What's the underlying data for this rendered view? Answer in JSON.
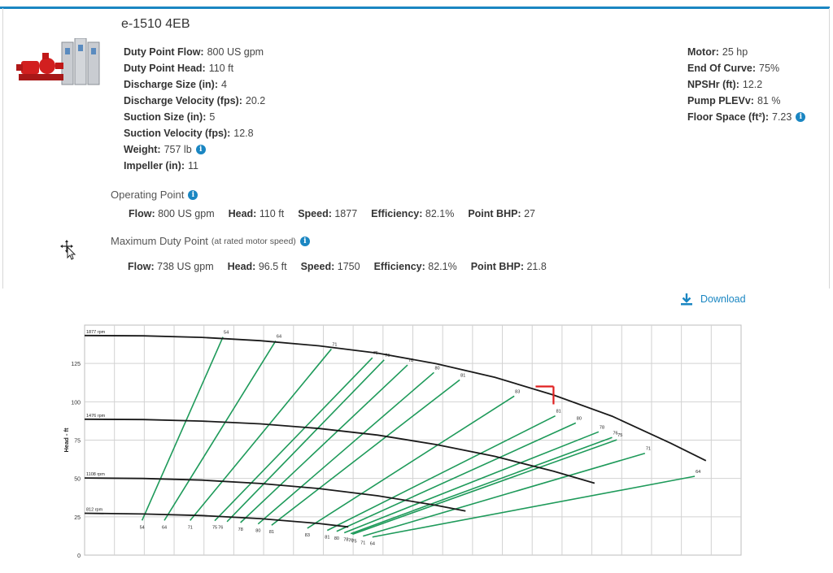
{
  "pump": {
    "title": "e-1510 4EB",
    "left_specs": [
      {
        "label": "Duty Point Flow:",
        "value": "800 US gpm",
        "info": false
      },
      {
        "label": "Duty Point Head:",
        "value": "110 ft",
        "info": false
      },
      {
        "label": "Discharge Size (in):",
        "value": "4",
        "info": false
      },
      {
        "label": "Discharge Velocity (fps):",
        "value": "20.2",
        "info": false
      },
      {
        "label": "Suction Size (in):",
        "value": "5",
        "info": false
      },
      {
        "label": "Suction Velocity (fps):",
        "value": "12.8",
        "info": false
      },
      {
        "label": "Weight:",
        "value": "757 lb",
        "info": true
      },
      {
        "label": "Impeller (in):",
        "value": "11",
        "info": false
      }
    ],
    "right_specs": [
      {
        "label": "Motor:",
        "value": "25 hp",
        "info": false
      },
      {
        "label": "End Of Curve:",
        "value": "75%",
        "info": false
      },
      {
        "label": "NPSHr (ft):",
        "value": "12.2",
        "info": false
      },
      {
        "label": "Pump PLEVv:",
        "value": "81 %",
        "info": false
      },
      {
        "label": "Floor Space (ft²):",
        "value": "7.23",
        "info": true
      }
    ]
  },
  "operating_point": {
    "heading": "Operating Point",
    "items": [
      {
        "label": "Flow:",
        "value": "800 US gpm"
      },
      {
        "label": "Head:",
        "value": "110 ft"
      },
      {
        "label": "Speed:",
        "value": "1877"
      },
      {
        "label": "Efficiency:",
        "value": "82.1%"
      },
      {
        "label": "Point BHP:",
        "value": "27"
      }
    ]
  },
  "max_duty_point": {
    "heading": "Maximum Duty Point",
    "note": "(at rated motor speed)",
    "items": [
      {
        "label": "Flow:",
        "value": "738 US gpm"
      },
      {
        "label": "Head:",
        "value": "96.5 ft"
      },
      {
        "label": "Speed:",
        "value": "1750"
      },
      {
        "label": "Efficiency:",
        "value": "82.1%"
      },
      {
        "label": "Point BHP:",
        "value": "21.8"
      }
    ]
  },
  "download_label": "Download",
  "icons": {
    "info": "info-icon",
    "download": "download-icon",
    "cursor": "move-cursor-icon"
  },
  "colors": {
    "accent": "#1a86c2",
    "curve": "#1a1a1a",
    "efficiency": "#1e9a5a",
    "marker": "#e02020"
  },
  "chart_data": {
    "type": "line",
    "ylabel": "Head - ft",
    "y_ticks": [
      "0",
      "25",
      "50",
      "75",
      "100",
      "125"
    ],
    "ylim": [
      0,
      150
    ],
    "xlim": [
      0,
      1120
    ],
    "grid": true,
    "speed_curves": [
      {
        "name": "1877 rpm",
        "points": [
          [
            0,
            143.2
          ],
          [
            100,
            143.0
          ],
          [
            200,
            142.0
          ],
          [
            300,
            139.8
          ],
          [
            400,
            136.5
          ],
          [
            500,
            131.7
          ],
          [
            600,
            124.8
          ],
          [
            700,
            115.9
          ],
          [
            800,
            104.4
          ],
          [
            900,
            90.6
          ],
          [
            1000,
            73.0
          ],
          [
            1060,
            61.6
          ]
        ]
      },
      {
        "name": "1476 rpm",
        "points": [
          [
            0,
            88.6
          ],
          [
            100,
            88.4
          ],
          [
            200,
            87.4
          ],
          [
            300,
            85.6
          ],
          [
            400,
            82.6
          ],
          [
            500,
            78.3
          ],
          [
            600,
            72.1
          ],
          [
            700,
            64.4
          ],
          [
            800,
            54.7
          ],
          [
            870,
            46.9
          ]
        ]
      },
      {
        "name": "1108 rpm",
        "points": [
          [
            0,
            50.3
          ],
          [
            100,
            50.0
          ],
          [
            200,
            48.9
          ],
          [
            300,
            46.7
          ],
          [
            400,
            43.4
          ],
          [
            500,
            38.7
          ],
          [
            600,
            32.5
          ],
          [
            650,
            28.8
          ]
        ]
      },
      {
        "name": "812 rpm",
        "points": [
          [
            0,
            27.3
          ],
          [
            100,
            26.8
          ],
          [
            200,
            25.8
          ],
          [
            300,
            23.8
          ],
          [
            400,
            20.6
          ],
          [
            450,
            18.4
          ]
        ]
      }
    ],
    "efficiency_lines": [
      {
        "name": "54",
        "points": [
          [
            98,
            22.6
          ],
          [
            236,
            142.2
          ]
        ]
      },
      {
        "name": "64",
        "points": [
          [
            136,
            22.6
          ],
          [
            326,
            139.7
          ]
        ]
      },
      {
        "name": "71",
        "points": [
          [
            180,
            22.6
          ],
          [
            421,
            134.4
          ]
        ]
      },
      {
        "name": "75",
        "points": [
          [
            222,
            22.4
          ],
          [
            491,
            128.7
          ]
        ]
      },
      {
        "name": "76",
        "points": [
          [
            243,
            21.8
          ],
          [
            511,
            127.3
          ]
        ]
      },
      {
        "name": "78",
        "points": [
          [
            266,
            21.2
          ],
          [
            551,
            124.0
          ]
        ]
      },
      {
        "name": "80",
        "points": [
          [
            296,
            20.3
          ],
          [
            596,
            119.1
          ]
        ]
      },
      {
        "name": "81",
        "points": [
          [
            319,
            19.5
          ],
          [
            640,
            114.3
          ]
        ]
      },
      {
        "name": "83",
        "points": [
          [
            380,
            17.5
          ],
          [
            733,
            103.7
          ]
        ]
      },
      {
        "name": "81",
        "points": [
          [
            414,
            16.1
          ],
          [
            803,
            90.8
          ]
        ]
      },
      {
        "name": "80",
        "points": [
          [
            430,
            15.5
          ],
          [
            838,
            86.2
          ]
        ]
      },
      {
        "name": "78",
        "points": [
          [
            443,
            14.6
          ],
          [
            877,
            80.4
          ]
        ]
      },
      {
        "name": "76",
        "points": [
          [
            454,
            14.0
          ],
          [
            900,
            76.7
          ]
        ]
      },
      {
        "name": "75",
        "points": [
          [
            457,
            13.6
          ],
          [
            908,
            75.2
          ]
        ]
      },
      {
        "name": "71",
        "points": [
          [
            475,
            12.4
          ],
          [
            956,
            66.4
          ]
        ]
      },
      {
        "name": "64",
        "points": [
          [
            491,
            11.8
          ],
          [
            1041,
            51.4
          ]
        ]
      }
    ],
    "top_labels": [
      {
        "text": "54",
        "x": 236,
        "y": 142.2
      },
      {
        "text": "64",
        "x": 326,
        "y": 139.7
      },
      {
        "text": "71",
        "x": 421,
        "y": 134.4
      },
      {
        "text": "75",
        "x": 491,
        "y": 128.7
      },
      {
        "text": "76",
        "x": 511,
        "y": 127.3
      },
      {
        "text": "78",
        "x": 551,
        "y": 124.0
      },
      {
        "text": "80",
        "x": 596,
        "y": 119.1
      },
      {
        "text": "81",
        "x": 640,
        "y": 114.3
      },
      {
        "text": "83",
        "x": 733,
        "y": 103.7
      },
      {
        "text": "81",
        "x": 803,
        "y": 90.8
      },
      {
        "text": "80",
        "x": 838,
        "y": 86.2
      },
      {
        "text": "78",
        "x": 877,
        "y": 80.4
      },
      {
        "text": "76",
        "x": 900,
        "y": 76.7
      },
      {
        "text": "75",
        "x": 908,
        "y": 75.2
      },
      {
        "text": "71",
        "x": 956,
        "y": 66.4
      },
      {
        "text": "64",
        "x": 1041,
        "y": 51.4
      }
    ],
    "bottom_labels": [
      {
        "text": "54",
        "x": 98,
        "y": 22.6
      },
      {
        "text": "64",
        "x": 136,
        "y": 22.6
      },
      {
        "text": "71",
        "x": 180,
        "y": 22.6
      },
      {
        "text": "75",
        "x": 222,
        "y": 22.4
      },
      {
        "text": "76",
        "x": 232,
        "y": 22.4
      },
      {
        "text": "78",
        "x": 266,
        "y": 21.2
      },
      {
        "text": "80",
        "x": 296,
        "y": 20.3
      },
      {
        "text": "81",
        "x": 319,
        "y": 19.5
      },
      {
        "text": "83",
        "x": 380,
        "y": 17.5
      },
      {
        "text": "81",
        "x": 414,
        "y": 16.1
      },
      {
        "text": "80",
        "x": 430,
        "y": 15.5
      },
      {
        "text": "78",
        "x": 446,
        "y": 14.6
      },
      {
        "text": "76",
        "x": 454,
        "y": 14.0
      },
      {
        "text": "75",
        "x": 460,
        "y": 13.6
      },
      {
        "text": "71",
        "x": 475,
        "y": 12.4
      },
      {
        "text": "64",
        "x": 491,
        "y": 11.8
      }
    ],
    "duty_point": {
      "x": 800,
      "y": 110
    }
  }
}
